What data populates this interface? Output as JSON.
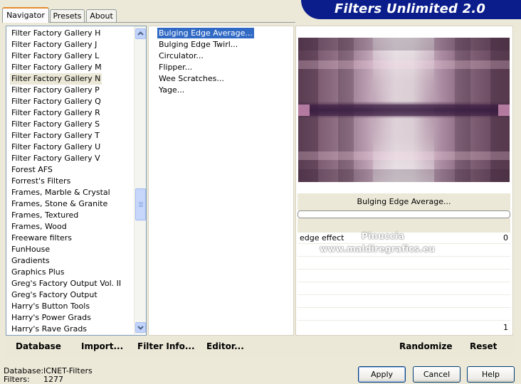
{
  "tabs": [
    "Navigator",
    "Presets",
    "About"
  ],
  "title": "Filters Unlimited 2.0",
  "categories": {
    "items": [
      "Filter Factory Gallery H",
      "Filter Factory Gallery J",
      "Filter Factory Gallery L",
      "Filter Factory Gallery M",
      "Filter Factory Gallery N",
      "Filter Factory Gallery P",
      "Filter Factory Gallery Q",
      "Filter Factory Gallery R",
      "Filter Factory Gallery S",
      "Filter Factory Gallery T",
      "Filter Factory Gallery U",
      "Filter Factory Gallery V",
      "Forest AFS",
      "Forrest's Filters",
      "Frames, Marble & Crystal",
      "Frames, Stone & Granite",
      "Frames, Textured",
      "Frames, Wood",
      "Freeware filters",
      "FunHouse",
      "Gradients",
      "Graphics Plus",
      "Greg's Factory Output Vol. II",
      "Greg's Factory Output",
      "Harry's Button Tools",
      "Harry's Power Grads",
      "Harry's Rave Grads"
    ],
    "selected": "Filter Factory Gallery N"
  },
  "filters": {
    "items": [
      "Bulging Edge Average...",
      "Bulging Edge Twirl...",
      "Circulator...",
      "Flipper...",
      "Wee Scratches...",
      "Yage..."
    ],
    "selected": "Bulging Edge Average..."
  },
  "current_filter": "Bulging Edge Average...",
  "controls": [
    {
      "label": "edge effect",
      "value": "0"
    },
    {
      "label": "",
      "value": "1"
    }
  ],
  "watermark": {
    "line1": "Pinuccia",
    "line2": "www.maldiregrafics.eu"
  },
  "bottom_links": {
    "database": "Database",
    "import": "Import...",
    "filter_info": "Filter Info...",
    "editor": "Editor...",
    "randomize": "Randomize",
    "reset": "Reset"
  },
  "footer": {
    "database_label": "Database:",
    "database_value": "ICNET-Filters",
    "filters_label": "Filters:",
    "filters_value": "1277"
  },
  "buttons": {
    "apply": "Apply",
    "cancel": "Cancel",
    "help": "Help"
  }
}
